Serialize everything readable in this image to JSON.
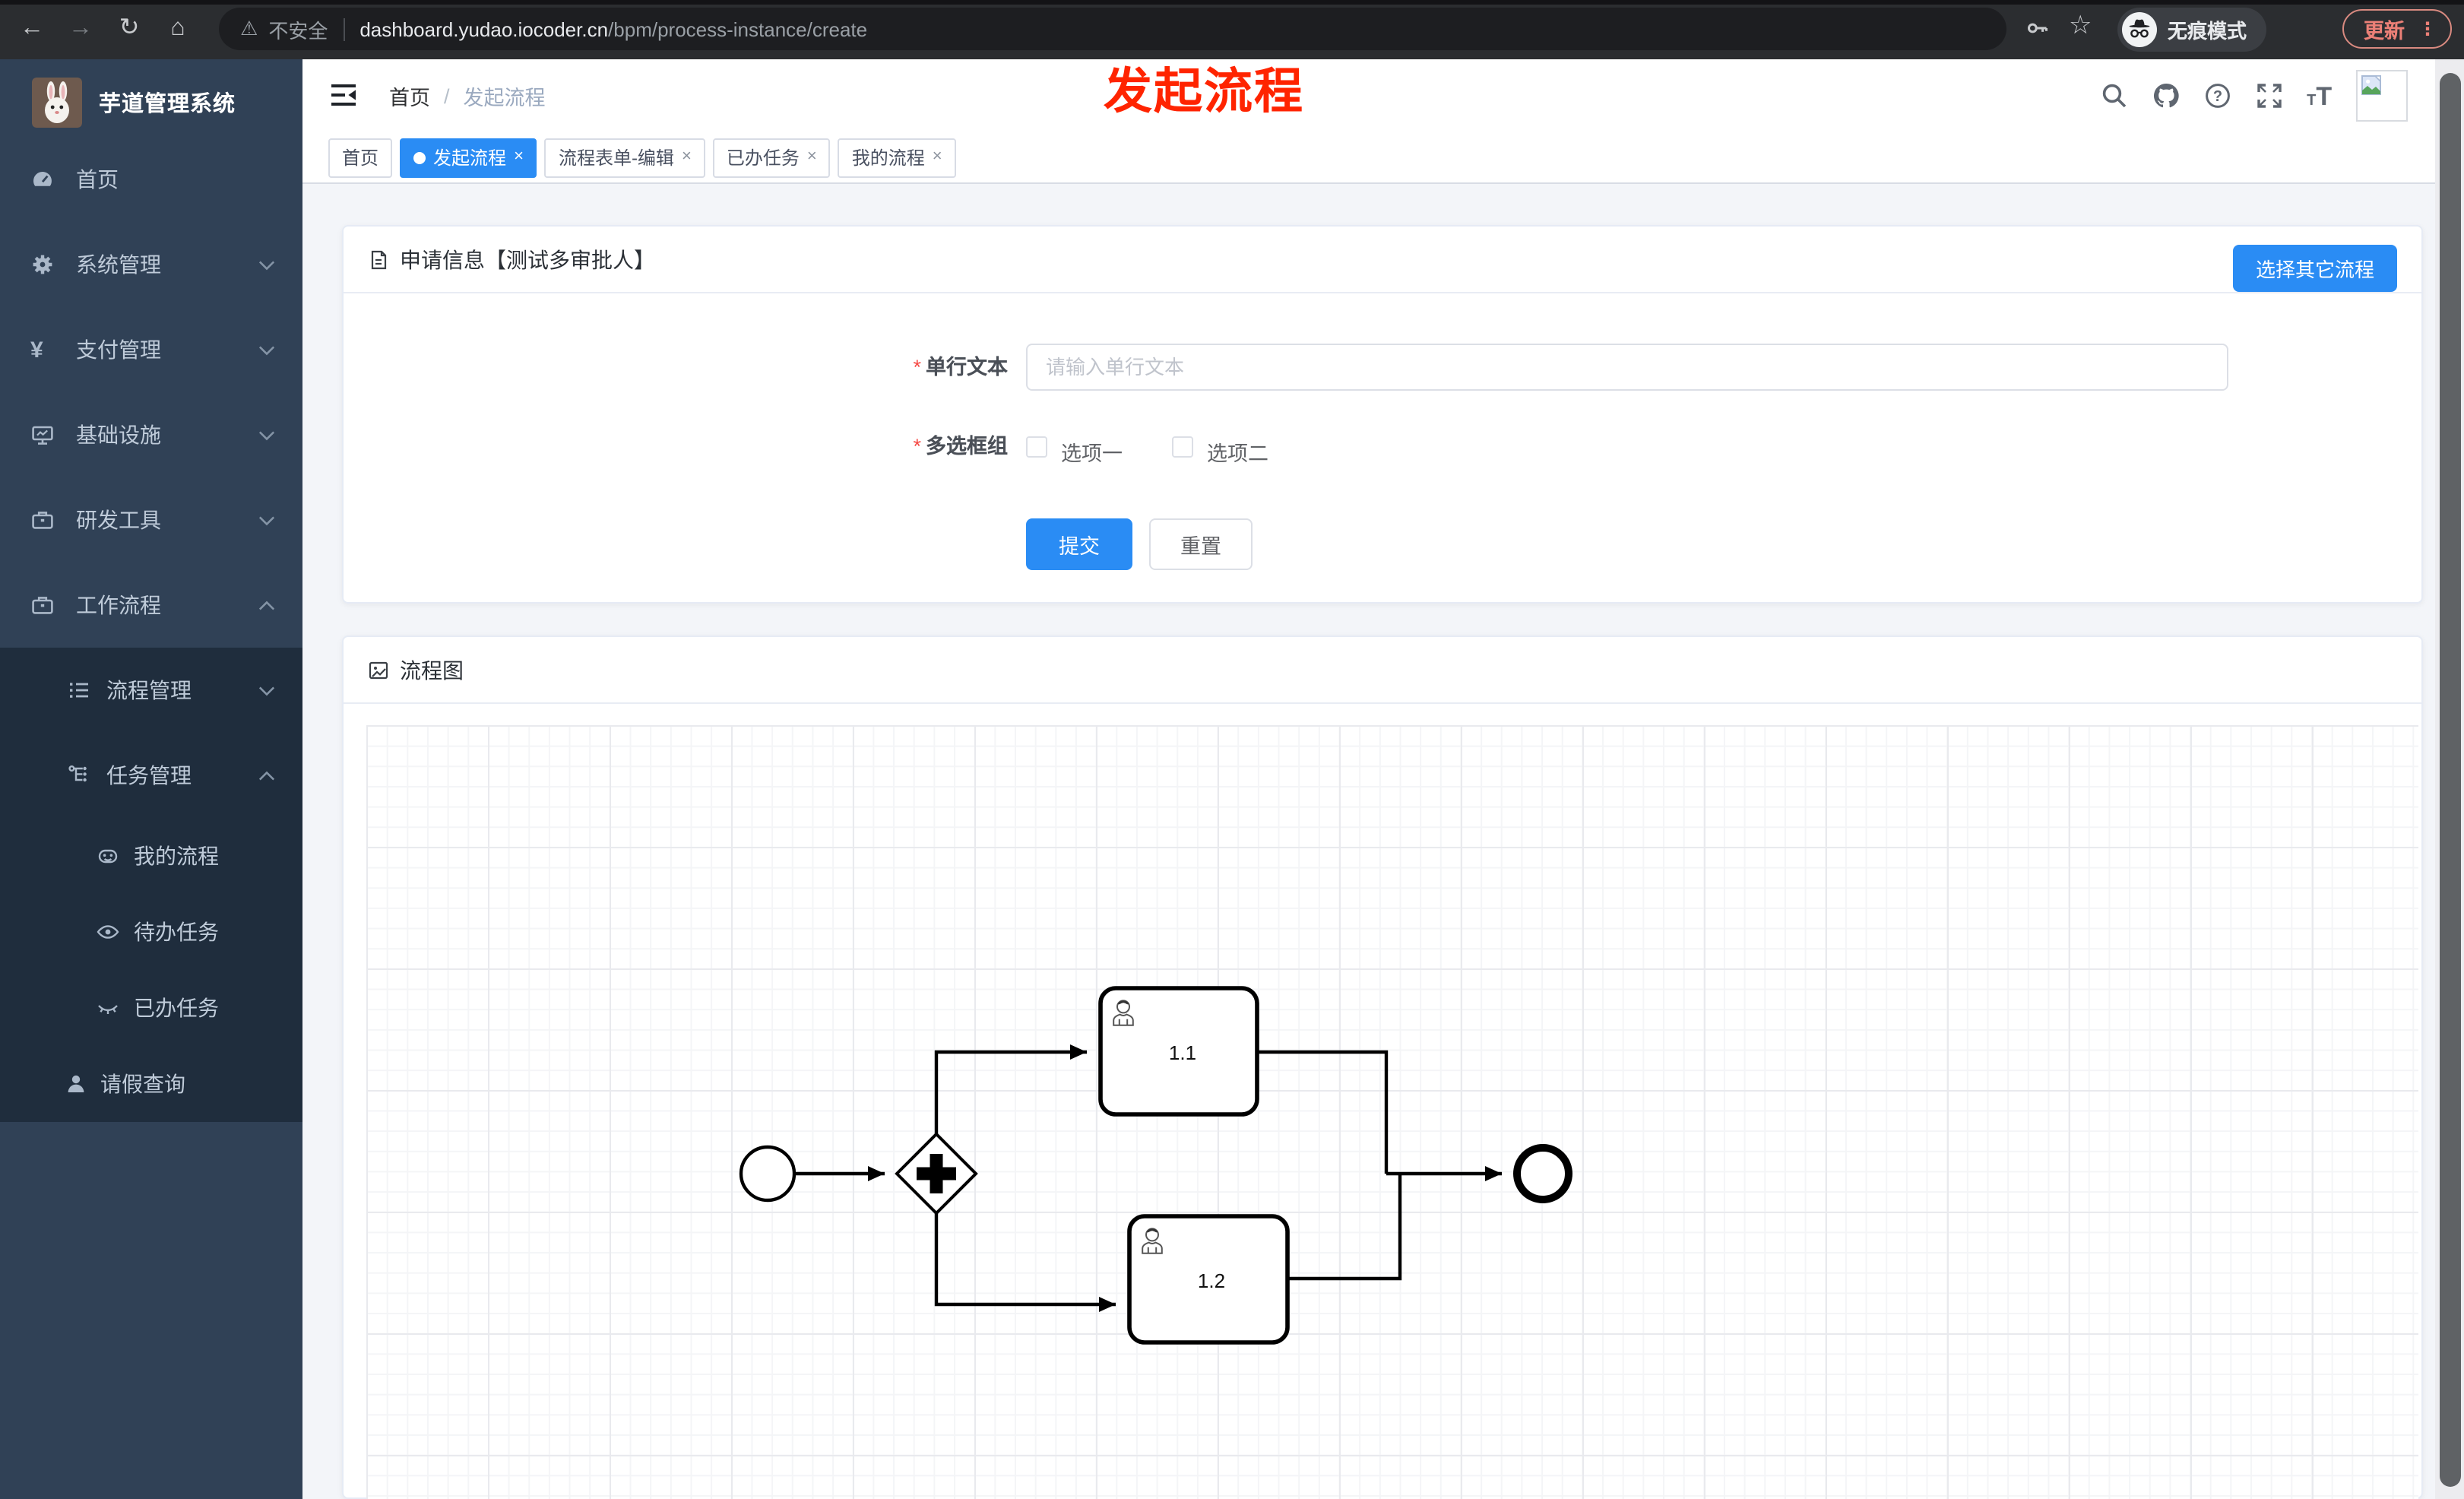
{
  "browser": {
    "security_label": "不安全",
    "url_host": "dashboard.yudao.iocoder.cn",
    "url_path": "/bpm/process-instance/create",
    "incognito_label": "无痕模式",
    "update_button": "更新"
  },
  "annotation": {
    "text": "发起流程",
    "color": "#ff2400"
  },
  "icons": {
    "back": "←",
    "forward": "→",
    "reload": "↻",
    "home": "⌂",
    "warning": "⚠",
    "star": "☆",
    "more_vertical": "⋮",
    "close": "×",
    "caret_down": "▼",
    "breadcrumb_sep": "/",
    "question_mark": "?",
    "letter_t": "T"
  },
  "sidebar": {
    "app_title": "芋道管理系统",
    "menu": [
      {
        "label": "首页",
        "icon": "dashboard-icon",
        "expandable": false
      },
      {
        "label": "系统管理",
        "icon": "gear-icon",
        "expandable": true,
        "expanded": false
      },
      {
        "label": "支付管理",
        "icon": "yen-icon",
        "expandable": true,
        "expanded": false
      },
      {
        "label": "基础设施",
        "icon": "monitor-icon",
        "expandable": true,
        "expanded": false
      },
      {
        "label": "研发工具",
        "icon": "toolbox-icon",
        "expandable": true,
        "expanded": false
      },
      {
        "label": "工作流程",
        "icon": "briefcase-icon",
        "expandable": true,
        "expanded": true
      }
    ],
    "submenu": [
      {
        "label": "流程管理",
        "icon": "list-icon",
        "expanded": false
      },
      {
        "label": "任务管理",
        "icon": "tree-icon",
        "expanded": true
      }
    ],
    "task_items": [
      {
        "label": "我的流程",
        "icon": "robot-icon"
      },
      {
        "label": "待办任务",
        "icon": "eye-open-icon"
      },
      {
        "label": "已办任务",
        "icon": "eye-closed-icon"
      },
      {
        "label": "请假查询",
        "icon": "user-icon"
      }
    ]
  },
  "header": {
    "breadcrumb": {
      "home": "首页",
      "current": "发起流程"
    }
  },
  "tabs": [
    {
      "label": "首页",
      "active": false,
      "closable": false
    },
    {
      "label": "发起流程",
      "active": true,
      "closable": true
    },
    {
      "label": "流程表单-编辑",
      "active": false,
      "closable": true
    },
    {
      "label": "已办任务",
      "active": false,
      "closable": true
    },
    {
      "label": "我的流程",
      "active": false,
      "closable": true
    }
  ],
  "form_card": {
    "title": "申请信息【测试多审批人】",
    "action_button": "选择其它流程",
    "required_mark": "*",
    "fields": [
      {
        "label": "单行文本",
        "required": true,
        "type": "text",
        "value": "",
        "placeholder": "请输入单行文本"
      },
      {
        "label": "多选框组",
        "required": true,
        "type": "checkbox-group",
        "options": [
          {
            "label": "选项一",
            "checked": false
          },
          {
            "label": "选项二",
            "checked": false
          }
        ]
      }
    ],
    "submit_button": "提交",
    "reset_button": "重置"
  },
  "diagram_card": {
    "title": "流程图",
    "process": {
      "type": "bpmn",
      "gateway": "parallel",
      "tasks": [
        {
          "label": "1.1"
        },
        {
          "label": "1.2"
        }
      ]
    }
  },
  "colors": {
    "primary_blue": "#2a8cf4",
    "sidebar_bg": "#304156",
    "sidebar_submenu_bg": "#1f2d3d",
    "annotation_red": "#ff2400",
    "chrome_bg": "#2b2d30"
  }
}
